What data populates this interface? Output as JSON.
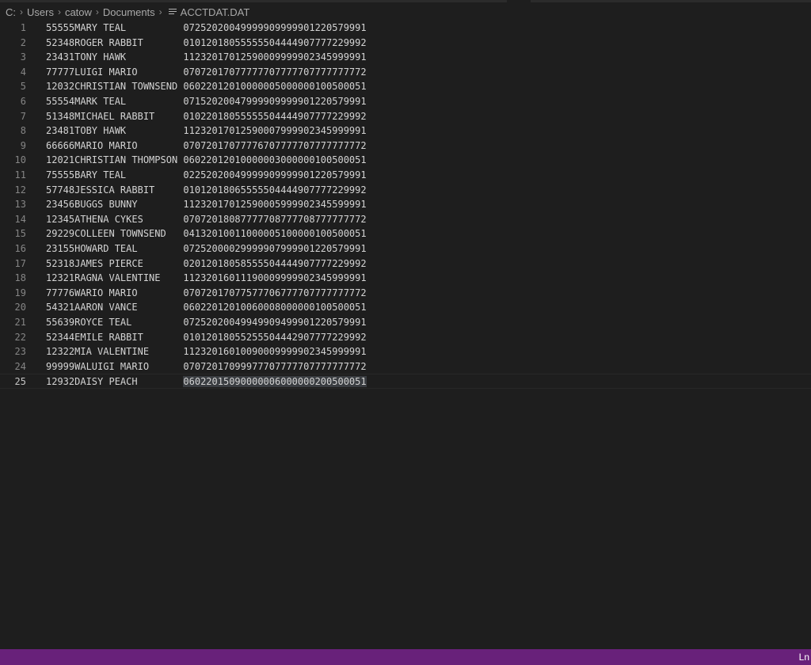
{
  "breadcrumb": {
    "items": [
      "C:",
      "Users",
      "catow",
      "Documents"
    ],
    "file": "ACCTDAT.DAT",
    "file_icon": "lines-file-icon"
  },
  "editor": {
    "current_line": 25,
    "lines": [
      {
        "n": "1",
        "id": "55555",
        "name": "MARY TEAL",
        "data": "07252020049999909999901220579991"
      },
      {
        "n": "2",
        "id": "52348",
        "name": "ROGER RABBIT",
        "data": "01012018055555504444907777229992"
      },
      {
        "n": "3",
        "id": "23431",
        "name": "TONY HAWK",
        "data": "11232017012590009999902345999991"
      },
      {
        "n": "4",
        "id": "77777",
        "name": "LUIGI MARIO",
        "data": "07072017077777707777707777777772"
      },
      {
        "n": "5",
        "id": "12032",
        "name": "CHRISTIAN TOWNSEND",
        "data": "06022012010000005000000100500051"
      },
      {
        "n": "6",
        "id": "55554",
        "name": "MARK TEAL",
        "data": "07152020047999909999901220579991"
      },
      {
        "n": "7",
        "id": "51348",
        "name": "MICHAEL RABBIT",
        "data": "01022018055555504444907777229992"
      },
      {
        "n": "8",
        "id": "23481",
        "name": "TOBY HAWK",
        "data": "11232017012590007999902345999991"
      },
      {
        "n": "9",
        "id": "66666",
        "name": "MARIO MARIO",
        "data": "07072017077776707777707777777772"
      },
      {
        "n": "10",
        "id": "12021",
        "name": "CHRISTIAN THOMPSON",
        "data": "06022012010000003000000100500051"
      },
      {
        "n": "11",
        "id": "75555",
        "name": "BARY TEAL",
        "data": "02252020049999909999901220579991"
      },
      {
        "n": "12",
        "id": "57748",
        "name": "JESSICA RABBIT",
        "data": "01012018065555504444907777229992"
      },
      {
        "n": "13",
        "id": "23456",
        "name": "BUGGS BUNNY",
        "data": "11232017012590005999902345599991"
      },
      {
        "n": "14",
        "id": "12345",
        "name": "ATHENA CYKES",
        "data": "07072018087777708777708777777772"
      },
      {
        "n": "15",
        "id": "29229",
        "name": "COLLEEN TOWNSEND",
        "data": "04132010011000005100000100500051"
      },
      {
        "n": "16",
        "id": "23155",
        "name": "HOWARD TEAL",
        "data": "07252000029999907999901220579991"
      },
      {
        "n": "17",
        "id": "52318",
        "name": "JAMES PIERCE",
        "data": "02012018058555504444907777229992"
      },
      {
        "n": "18",
        "id": "12321",
        "name": "RAGNA VALENTINE",
        "data": "11232016011190009999902345999991"
      },
      {
        "n": "19",
        "id": "77776",
        "name": "WARIO MARIO",
        "data": "07072017077577706777707777777772"
      },
      {
        "n": "20",
        "id": "54321",
        "name": "AARON VANCE",
        "data": "06022012010060008000000100500051"
      },
      {
        "n": "21",
        "id": "55639",
        "name": "ROYCE TEAL",
        "data": "07252020049949909499901220579991"
      },
      {
        "n": "22",
        "id": "52344",
        "name": "EMILE RABBIT",
        "data": "01012018055255504442907777229992"
      },
      {
        "n": "23",
        "id": "12322",
        "name": "MIA VALENTINE",
        "data": "11232016010090009999902345999991"
      },
      {
        "n": "24",
        "id": "99999",
        "name": "WALUIGI MARIO",
        "data": "07072017099977707777707777777772"
      },
      {
        "n": "25",
        "id": "12932",
        "name": "DAISY PEACH",
        "data": "06022015090000006000000200500051"
      }
    ]
  },
  "statusbar": {
    "position_label": "Ln"
  }
}
